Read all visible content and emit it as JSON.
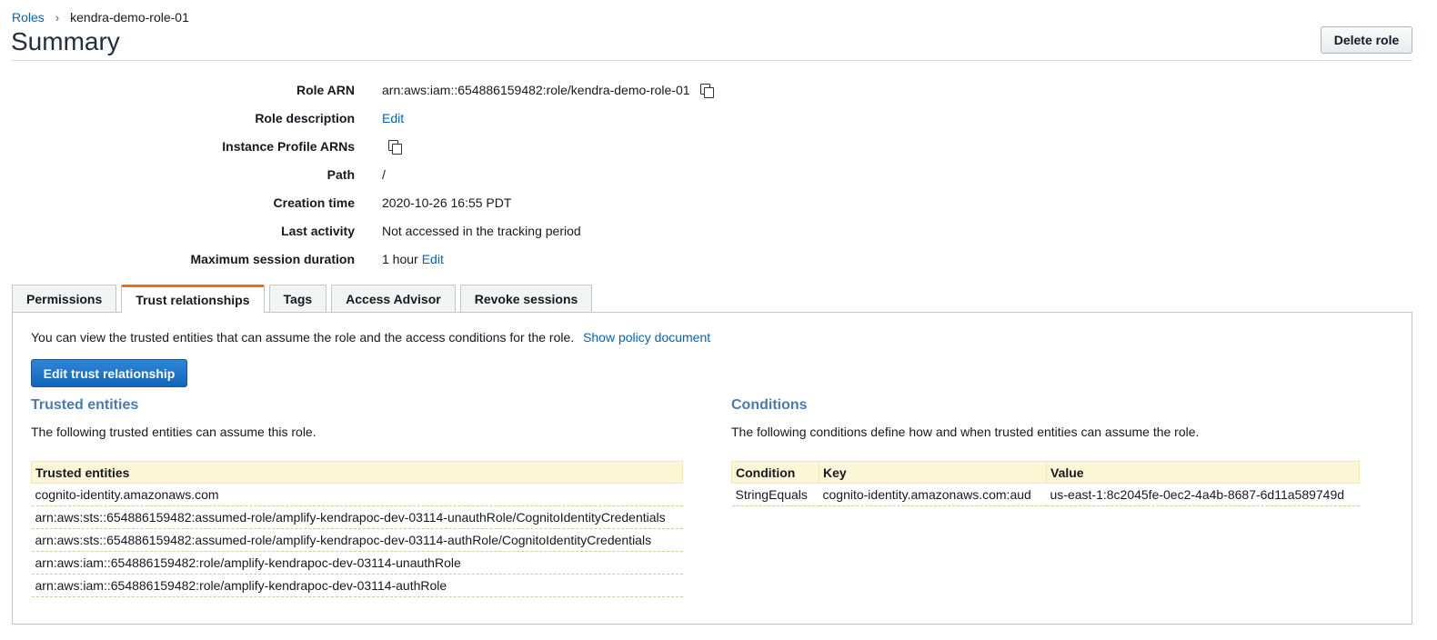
{
  "breadcrumb": {
    "root": "Roles",
    "current": "kendra-demo-role-01"
  },
  "title": "Summary",
  "delete_button": "Delete role",
  "summary": {
    "role_arn_label": "Role ARN",
    "role_arn_value": "arn:aws:iam::654886159482:role/kendra-demo-role-01",
    "role_description_label": "Role description",
    "role_description_edit": "Edit",
    "instance_profile_label": "Instance Profile ARNs",
    "path_label": "Path",
    "path_value": "/",
    "creation_time_label": "Creation time",
    "creation_time_value": "2020-10-26 16:55 PDT",
    "last_activity_label": "Last activity",
    "last_activity_value": "Not accessed in the tracking period",
    "max_session_label": "Maximum session duration",
    "max_session_value": "1 hour",
    "max_session_edit": "Edit"
  },
  "tabs": [
    "Permissions",
    "Trust relationships",
    "Tags",
    "Access Advisor",
    "Revoke sessions"
  ],
  "active_tab": "Trust relationships",
  "trust": {
    "intro": "You can view the trusted entities that can assume the role and the access conditions for the role.",
    "show_policy_link": "Show policy document",
    "edit_button": "Edit trust relationship",
    "entities_title": "Trusted entities",
    "entities_desc": "The following trusted entities can assume this role.",
    "entities_header": "Trusted entities",
    "entities": [
      "cognito-identity.amazonaws.com",
      "arn:aws:sts::654886159482:assumed-role/amplify-kendrapoc-dev-03114-unauthRole/CognitoIdentityCredentials",
      "arn:aws:sts::654886159482:assumed-role/amplify-kendrapoc-dev-03114-authRole/CognitoIdentityCredentials",
      "arn:aws:iam::654886159482:role/amplify-kendrapoc-dev-03114-unauthRole",
      "arn:aws:iam::654886159482:role/amplify-kendrapoc-dev-03114-authRole"
    ],
    "conditions_title": "Conditions",
    "conditions_desc": "The following conditions define how and when trusted entities can assume the role.",
    "conditions_headers": {
      "condition": "Condition",
      "key": "Key",
      "value": "Value"
    },
    "conditions": [
      {
        "condition": "StringEquals",
        "key": "cognito-identity.amazonaws.com:aud",
        "value": "us-east-1:8c2045fe-0ec2-4a4b-8687-6d11a589749d"
      }
    ]
  },
  "colors": {
    "link": "#0066bb",
    "tab_accent": "#ec7211",
    "primary_button": "#1166bb",
    "table_header": "#fbf6d6",
    "section_title": "#4a7aaf"
  }
}
